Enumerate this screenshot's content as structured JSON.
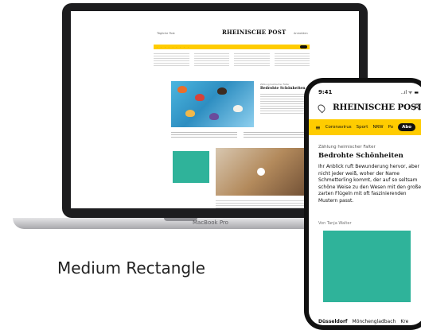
{
  "desktop": {
    "top_left_link": "Tägliche Post",
    "logo": "RHEINISCHE POST",
    "top_right_link": "Anmelden",
    "hero_kicker": "Zählung heimischer Falter",
    "hero_headline": "Bedrohte Schönheiten",
    "laptop_brand": "MacBook Pro"
  },
  "phone": {
    "time": "9:41",
    "status_icons": "..ıl ᯤ ▬",
    "logo": "RHEINISCHE POST",
    "menu_icon": "≡",
    "nav_items": [
      "Coronavirus",
      "Sport",
      "NRW",
      "Po"
    ],
    "abo_label": "Abo",
    "kicker": "Zählung heimischer Falter",
    "headline": "Bedrohte Schönheiten",
    "body": "Ihr Anblick ruft Bewunderung hervor, aber nicht jeder weiß, woher der Name Schmetterling kommt, der auf so seltsam schöne Weise zu den Wesen mit den großen, zarten Flügeln mit oft faszinierenden Mustern passt.",
    "author": "Von Tanja Walter",
    "bottom_nav": [
      "Düsseldorf",
      "Mönchengladbach",
      "Kre"
    ]
  },
  "caption": "Medium Rectangle",
  "colors": {
    "accent_yellow": "#ffcc00",
    "ad_teal": "#2fb39a"
  }
}
